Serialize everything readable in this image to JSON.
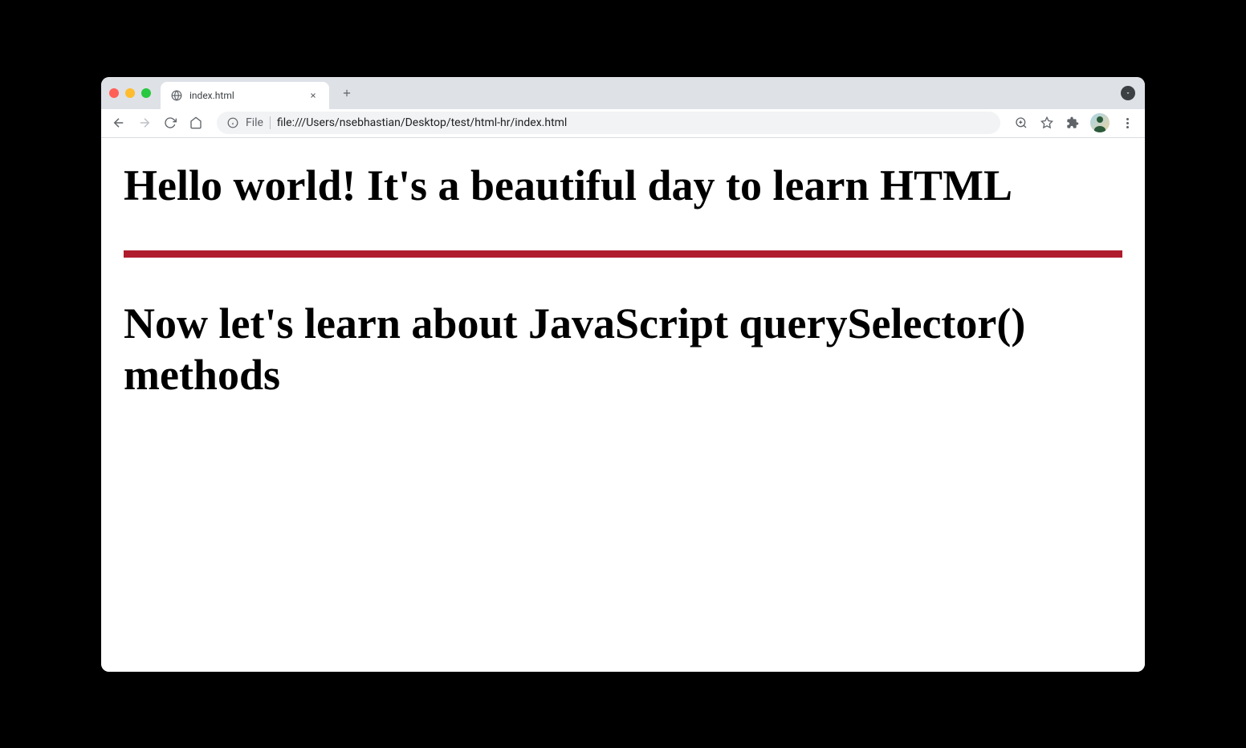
{
  "browser": {
    "tab": {
      "title": "index.html"
    },
    "address": {
      "file_label": "File",
      "url": "file:///Users/nsebhastian/Desktop/test/html-hr/index.html"
    }
  },
  "page": {
    "heading1": "Hello world! It's a beautiful day to learn HTML",
    "heading2": "Now let's learn about JavaScript querySelector() methods",
    "hr_color": "#b01c2e"
  }
}
